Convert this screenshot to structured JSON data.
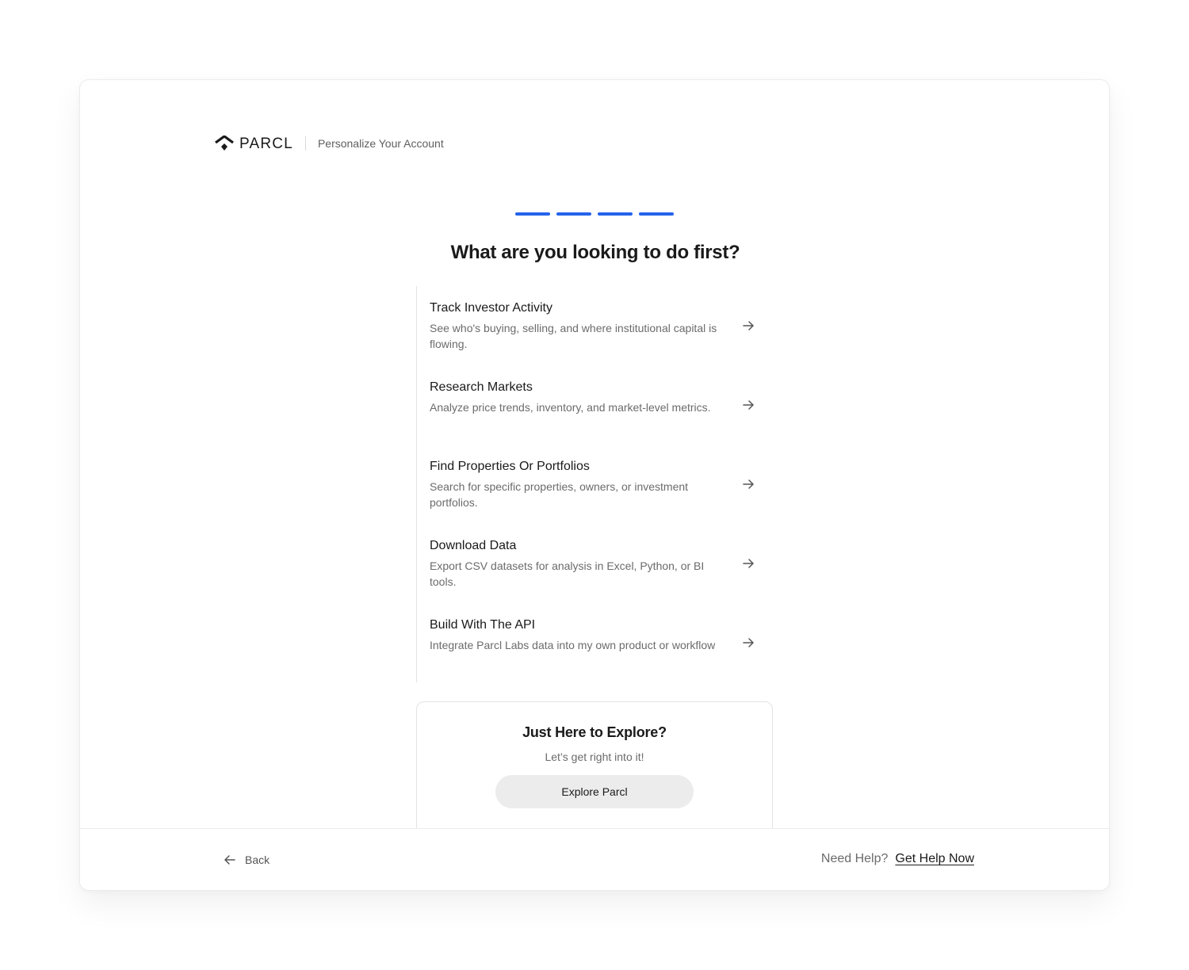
{
  "header": {
    "logo_text": "PARCL",
    "subtitle": "Personalize Your Account"
  },
  "progress": {
    "total_steps": 4,
    "completed_steps": 4,
    "color": "#2563eb"
  },
  "question": "What are you looking to do first?",
  "options": [
    {
      "title": "Track Investor Activity",
      "desc": "See who's buying, selling, and where institutional capital is flowing."
    },
    {
      "title": "Research Markets",
      "desc": "Analyze price trends, inventory, and market-level metrics."
    },
    {
      "title": "Find Properties Or Portfolios",
      "desc": "Search for specific properties, owners, or investment portfolios."
    },
    {
      "title": "Download Data",
      "desc": "Export CSV datasets for analysis in Excel, Python, or BI tools."
    },
    {
      "title": "Build With The API",
      "desc": "Integrate Parcl Labs data into my own product or workflow"
    }
  ],
  "explore": {
    "title": "Just Here to Explore?",
    "subtitle": "Let’s get right into it!",
    "button_label": "Explore Parcl"
  },
  "footer": {
    "back_label": "Back",
    "help_prompt": "Need Help?",
    "help_link": "Get Help Now"
  },
  "icons": {
    "logo": "parcl-logo-icon",
    "option_arrow": "arrow-right-icon",
    "back": "arrow-left-icon"
  }
}
